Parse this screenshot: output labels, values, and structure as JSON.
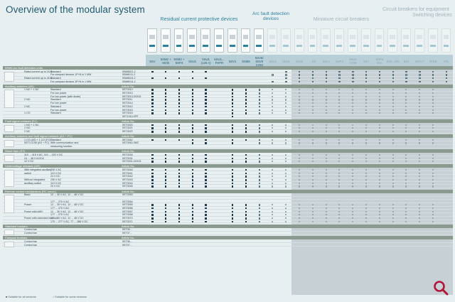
{
  "title": "Overview of the modular system",
  "groups": [
    {
      "id": "rcpd",
      "label": "Residual current protective devices",
      "color": "#2b7fa0"
    },
    {
      "id": "afdd",
      "label": "Arc fault detection devices",
      "color": "#2b7fa0"
    },
    {
      "id": "mcb",
      "label": "Miniature circuit breakers",
      "color": "#9fb3bc"
    },
    {
      "id": "cbe",
      "label": "Circuit breakers for equipment",
      "color": "#9fb3bc"
    },
    {
      "id": "switch",
      "label": "Switching devices",
      "color": "#9fb3bc"
    }
  ],
  "columns": [
    {
      "label": "5SV",
      "grey": false
    },
    {
      "label": "5SM2 + MCB",
      "grey": false
    },
    {
      "label": "5SM2 + 5SP4",
      "grey": false
    },
    {
      "label": "5SU1",
      "grey": false
    },
    {
      "label": "5SU1 (125 A)",
      "grey": false
    },
    {
      "label": "5SU1... FHFR",
      "grey": false
    },
    {
      "label": "5SV1",
      "grey": false
    },
    {
      "label": "5SM6",
      "grey": false
    },
    {
      "label": "5SV6/ 5SV8 COM",
      "grey": false
    },
    {
      "label": "5SL3",
      "grey": true
    },
    {
      "label": "5SL6",
      "grey": true
    },
    {
      "label": "5SJ6",
      "grey": true
    },
    {
      "label": "...ES",
      "grey": true
    },
    {
      "label": "5SL4",
      "grey": true
    },
    {
      "label": "5SP4",
      "grey": true
    },
    {
      "label": "5SL6 COM",
      "grey": true
    },
    {
      "label": "5SY",
      "grey": true
    },
    {
      "label": "5SP4 60A",
      "grey": true
    },
    {
      "label": "5SX...MG",
      "grey": true
    },
    {
      "label": "5SJ",
      "grey": true
    },
    {
      "label": "5SY17",
      "grey": true
    },
    {
      "label": "5TE8",
      "grey": true
    },
    {
      "label": "5TL",
      "grey": true
    }
  ],
  "sections": [
    {
      "title": "5SM6 arc fault detection units",
      "rows": [
        {
          "a": "Rated current up to 16 A",
          "b": "Standard",
          "art": "5SM6021-2",
          "pat": "mmmmm-----ooooooooooooo"
        },
        {
          "a": "",
          "b": "For compact devices 1P+N in 1 MW",
          "art": "5SM6011-2",
          "pat": "---------oooooooooooooo"
        },
        {
          "a": "Rated current up to 40 A",
          "b": "Standard",
          "art": "5SM6024-2",
          "pat": "mmmmm-----ooooooooooooo"
        },
        {
          "a": "",
          "b": "For compact devices 1P+N in 1 MW",
          "art": "5SM6014-2",
          "pat": "---------oooooooooooooo"
        }
      ]
    },
    {
      "title": "Auxiliary switches (AS)",
      "art": "Article No.",
      "rows": [
        {
          "a": "1 NO + 1 NC",
          "b": "Standard",
          "art": "5ST3010",
          "pat": "mmmmm-mmoggggggggggggg"
        },
        {
          "a": "",
          "b": "For low power",
          "art": "5ST3013",
          "pat": "mmmmm-mmoggggggggggggg"
        },
        {
          "a": "",
          "b": "For low power (with diode)",
          "art": "5ST3013-0XX01",
          "pat": "mmmmm-mmoggggggggggggg"
        },
        {
          "a": "2 NO",
          "b": "Standard",
          "art": "5ST3011",
          "pat": "mmmmm-mmoggggggggggggg"
        },
        {
          "a": "",
          "b": "For low power",
          "art": "5ST3014",
          "pat": "mmmmm-mmoggggggggggggg"
        },
        {
          "a": "2 NC",
          "b": "Standard",
          "art": "5ST3012",
          "pat": "mmmmm-mmoggggggggggggg"
        },
        {
          "a": "",
          "b": "For low power",
          "art": "5ST3015",
          "pat": "mmmmm-mmoggggggggggggg"
        },
        {
          "a": "1 CO",
          "b": "Standard",
          "art": "5ST3016",
          "pat": "mmmmm-mmoggggggggggggg"
        },
        {
          "a": "",
          "b": "",
          "art": "5ST1010-0FP",
          "pat": "------m----------------"
        }
      ]
    },
    {
      "title": "Fault signal contacts (FC)",
      "art": "Article No.",
      "rows": [
        {
          "a": "1 NO + 1 NC",
          "b": "",
          "art": "5ST3020",
          "pat": "mmmmm-mmoggggggggggggg"
        },
        {
          "a": "2 NO",
          "b": "",
          "art": "5ST3021",
          "pat": "mmmmm-mmoggggggggggggg"
        },
        {
          "a": "2 NC",
          "b": "",
          "art": "5ST3022",
          "pat": "mmmmm-mmoggggggggggggg"
        }
      ]
    },
    {
      "title": "Auxiliary switches and fault signal contacts (AS + FC)",
      "art": "Article No.",
      "rows": [
        {
          "a": "1 CO (AS) + 1 CO (FC)",
          "b": "Standard",
          "art": "5ST3062",
          "pat": "mmmmm-mmoggggggggggggg"
        },
        {
          "a": "5ST3 COM (AS + FC)",
          "b": "With communication and",
          "art": "5ST3062-0MC",
          "pat": "---mm-m-oggggggggggggg"
        },
        {
          "a": "",
          "b": "measuring function",
          "art": "",
          "pat": "-----------------------"
        }
      ]
    },
    {
      "title": "Shunt trips (ST)",
      "art": "Article No.",
      "rows": [
        {
          "a": "110 ... 415 V AC, 110 ... 220 V DC",
          "b": "",
          "art": "5ST3030",
          "pat": "mmmmm-mmoggggggggggggg"
        },
        {
          "a": "24 ... 48 V AC/DC",
          "b": "",
          "art": "5ST3031",
          "pat": "mmmmm-mmoggggggggggggg"
        },
        {
          "a": "12 V DC",
          "b": "",
          "art": "5ST3031-0XX01",
          "pat": "mmmmm-mmoggggggggggggg"
        }
      ]
    },
    {
      "title": "Undervoltage releases (UR)",
      "art": "Article No.",
      "rows": [
        {
          "a": "With integrated auxiliary",
          "b": "230 V AC",
          "art": "5ST3040",
          "pat": "mmmmm-mmoggggggggggggg"
        },
        {
          "a": "switch",
          "b": "110 V DC",
          "art": "5ST3041",
          "pat": "mmmmm-mmoggggggggggggg"
        },
        {
          "a": "",
          "b": "24 V DC",
          "art": "5ST3042",
          "pat": "mmmmm-mmoggggggggggggg"
        },
        {
          "a": "Without integrated",
          "b": "230 V AC",
          "art": "5ST3043",
          "pat": "mmmmm-mmoggggggggggggg"
        },
        {
          "a": "auxiliary switch",
          "b": "110 V DC",
          "art": "5ST3044",
          "pat": "mmmmm-mmoggggggggggggg"
        },
        {
          "a": "",
          "b": "24 V DC",
          "art": "5ST3045",
          "pat": "mmmmm-mmoggggggggggggg"
        }
      ]
    },
    {
      "title": "Remote control mechanisms (RC mech.)",
      "art": "Article No.",
      "rows": [
        {
          "a": "Basic",
          "b": "12 ... 30 V AC, 12 ... 48 V DC",
          "art": "5ST3053",
          "pat": "-----------------------"
        },
        {
          "a": "",
          "b": "",
          "art": "",
          "pat": "-----------------------"
        },
        {
          "a": "",
          "b": "177 ... 270 V AC",
          "art": "5ST3054",
          "pat": "-----------------------"
        },
        {
          "a": "Power",
          "b": "12 ... 30 V AC, 12 ... 48 V DC",
          "art": "5ST3055",
          "pat": "mmmmm-mmoggggggggggggg"
        },
        {
          "a": "",
          "b": "177 ... 270 V AC",
          "art": "5ST3056",
          "pat": "mmmmm-mmoggggggggggggg"
        },
        {
          "a": "Power with AHD",
          "b": "12 ... 30 V AC, 12 ... 48 V DC",
          "art": "5ST3057",
          "pat": "mmmmm-mmoggggggggggggg"
        },
        {
          "a": "",
          "b": "177 ... 270 V AC",
          "art": "5ST3058",
          "pat": "mmmmm-mmoggggggggggggg"
        },
        {
          "a": "Power with extended function",
          "b": "12 ... 30 V AC, 12 ... 48 V DC",
          "art": "5ST3070",
          "pat": "mmmmm-mmoggggggggggggg"
        },
        {
          "a": "",
          "b": "170 ... 277 V AC, 77 ... 286 V DC",
          "art": "5ST3071",
          "pat": "mmmmm-mmoggggggggggggg"
        }
      ]
    },
    {
      "title": "Standard busbars",
      "art": "Article No.",
      "rows": [
        {
          "a": "Control bar",
          "b": "",
          "art": "5ST36...",
          "pat": "-----------------------"
        },
        {
          "a": "Control bar",
          "b": "",
          "art": "5ST37...",
          "pat": "-----------------------"
        }
      ]
    },
    {
      "title": "Compact busbars",
      "art": "Article No.",
      "rows": [
        {
          "a": "Control bar",
          "b": "",
          "art": "5ST36...",
          "pat": "-----------------------"
        },
        {
          "a": "Control bar",
          "b": "",
          "art": "5ST37...",
          "pat": "-----------------------"
        }
      ]
    }
  ],
  "footer": {
    "legend1": "■ Suitable for all versions",
    "legend2": "○ Suitable for some versions"
  },
  "search_icon": "magnifier-icon",
  "accent_color": "#1f5a72",
  "brand_red": "#b3143a"
}
